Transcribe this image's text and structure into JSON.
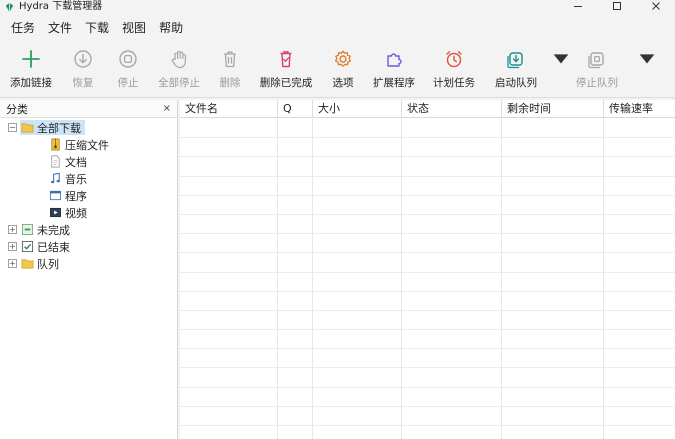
{
  "window": {
    "title": "Hydra 下载管理器",
    "controls": [
      "minimize-icon",
      "maximize-icon",
      "close-icon"
    ]
  },
  "menu": [
    "任务",
    "文件",
    "下载",
    "视图",
    "帮助"
  ],
  "toolbar": {
    "buttons": [
      {
        "id": "add-link",
        "label": "添加链接",
        "icon": "plus-icon",
        "enabled": true
      },
      {
        "id": "resume",
        "label": "恢复",
        "icon": "resume-download-icon",
        "enabled": false
      },
      {
        "id": "stop",
        "label": "停止",
        "icon": "stop-circle-icon",
        "enabled": false
      },
      {
        "id": "stop-all",
        "label": "全部停止",
        "icon": "hand-stop-icon",
        "enabled": false
      },
      {
        "id": "delete",
        "label": "删除",
        "icon": "trash-icon",
        "enabled": false
      },
      {
        "id": "delete-completed",
        "label": "删除已完成",
        "icon": "trash-completed-icon",
        "enabled": true
      },
      {
        "id": "options",
        "label": "选项",
        "icon": "gear-icon",
        "enabled": true
      },
      {
        "id": "extensions",
        "label": "扩展程序",
        "icon": "puzzle-icon",
        "enabled": true
      },
      {
        "id": "scheduler",
        "label": "计划任务",
        "icon": "alarm-clock-icon",
        "enabled": true
      },
      {
        "id": "start-queue",
        "label": "启动队列",
        "icon": "queue-start-icon",
        "enabled": true
      },
      {
        "id": "stop-queue",
        "label": "停止队列",
        "icon": "queue-stop-icon",
        "enabled": false
      }
    ]
  },
  "sidebar": {
    "title": "分类",
    "close_glyph": "×",
    "tree": [
      {
        "label": "全部下载",
        "icon": "folder-icon",
        "level": 0,
        "expander": "−",
        "selected": true
      },
      {
        "label": "压缩文件",
        "icon": "archive-icon",
        "level": 1
      },
      {
        "label": "文档",
        "icon": "document-icon",
        "level": 1
      },
      {
        "label": "音乐",
        "icon": "music-note-icon",
        "level": 1
      },
      {
        "label": "程序",
        "icon": "program-window-icon",
        "level": 1
      },
      {
        "label": "视频",
        "icon": "video-icon",
        "level": 1
      },
      {
        "label": "未完成",
        "icon": "incomplete-icon",
        "level": 0,
        "expander": "+"
      },
      {
        "label": "已结束",
        "icon": "checkbox-check-icon",
        "level": 0,
        "expander": "+"
      },
      {
        "label": "队列",
        "icon": "folder-icon",
        "level": 0,
        "expander": "+"
      }
    ]
  },
  "table": {
    "columns": [
      "文件名",
      "Q",
      "大小",
      "状态",
      "剩余时间",
      "传输速率"
    ],
    "rows": []
  },
  "colors": {
    "accent_green": "#2e9e5b",
    "selection": "#cce4f7",
    "delete_pink": "#d8407a",
    "gear_orange": "#e07a26",
    "puzzle_purple": "#6f5bd6",
    "clock_red": "#e0533d",
    "queue_teal": "#1a8f8f",
    "disabled_gray": "#a8a8a8"
  }
}
